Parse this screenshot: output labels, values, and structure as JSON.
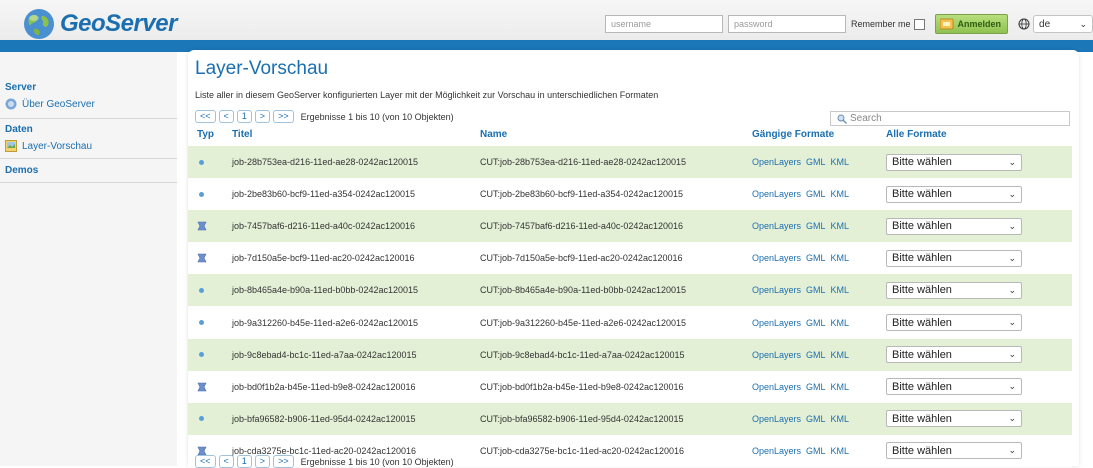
{
  "header": {
    "logo_text": "GeoServer",
    "username_placeholder": "username",
    "password_placeholder": "password",
    "remember_me": "Remember me",
    "login_button": "Anmelden",
    "language": "de"
  },
  "sidebar": {
    "server": "Server",
    "about": "Über GeoServer",
    "data": "Daten",
    "layer_preview": "Layer-Vorschau",
    "demos": "Demos"
  },
  "main": {
    "title": "Layer-Vorschau",
    "description": "Liste aller in diesem GeoServer konfigurierten Layer mit der Möglichkeit zur Vorschau in unterschiedlichen Formaten",
    "pager": {
      "first": "<<",
      "prev": "<",
      "page": "1",
      "next": ">",
      "last": ">>",
      "results": "Ergebnisse 1 bis 10 (von 10 Objekten)"
    },
    "search_placeholder": "Search",
    "columns": {
      "type": "Typ",
      "title": "Titel",
      "name": "Name",
      "common_formats": "Gängige Formate",
      "all_formats": "Alle Formate"
    },
    "format_links": [
      "OpenLayers",
      "GML",
      "KML"
    ],
    "select_default": "Bitte wählen",
    "rows": [
      {
        "type": "point",
        "title": "job-28b753ea-d216-11ed-ae28-0242ac120015",
        "name": "CUT:job-28b753ea-d216-11ed-ae28-0242ac120015"
      },
      {
        "type": "point",
        "title": "job-2be83b60-bcf9-11ed-a354-0242ac120015",
        "name": "CUT:job-2be83b60-bcf9-11ed-a354-0242ac120015"
      },
      {
        "type": "polygon",
        "title": "job-7457baf6-d216-11ed-a40c-0242ac120016",
        "name": "CUT:job-7457baf6-d216-11ed-a40c-0242ac120016"
      },
      {
        "type": "polygon",
        "title": "job-7d150a5e-bcf9-11ed-ac20-0242ac120016",
        "name": "CUT:job-7d150a5e-bcf9-11ed-ac20-0242ac120016"
      },
      {
        "type": "point",
        "title": "job-8b465a4e-b90a-11ed-b0bb-0242ac120015",
        "name": "CUT:job-8b465a4e-b90a-11ed-b0bb-0242ac120015"
      },
      {
        "type": "point",
        "title": "job-9a312260-b45e-11ed-a2e6-0242ac120015",
        "name": "CUT:job-9a312260-b45e-11ed-a2e6-0242ac120015"
      },
      {
        "type": "point",
        "title": "job-9c8ebad4-bc1c-11ed-a7aa-0242ac120015",
        "name": "CUT:job-9c8ebad4-bc1c-11ed-a7aa-0242ac120015"
      },
      {
        "type": "polygon",
        "title": "job-bd0f1b2a-b45e-11ed-b9e8-0242ac120016",
        "name": "CUT:job-bd0f1b2a-b45e-11ed-b9e8-0242ac120016"
      },
      {
        "type": "point",
        "title": "job-bfa96582-b906-11ed-95d4-0242ac120015",
        "name": "CUT:job-bfa96582-b906-11ed-95d4-0242ac120015"
      },
      {
        "type": "polygon",
        "title": "job-cda3275e-bc1c-11ed-ac20-0242ac120016",
        "name": "CUT:job-cda3275e-bc1c-11ed-ac20-0242ac120016"
      }
    ]
  },
  "colors": {
    "brand_blue": "#1b77b8",
    "link_blue": "#1b6fb0",
    "row_green": "#e3f0d6",
    "login_green": "#8fc150"
  }
}
